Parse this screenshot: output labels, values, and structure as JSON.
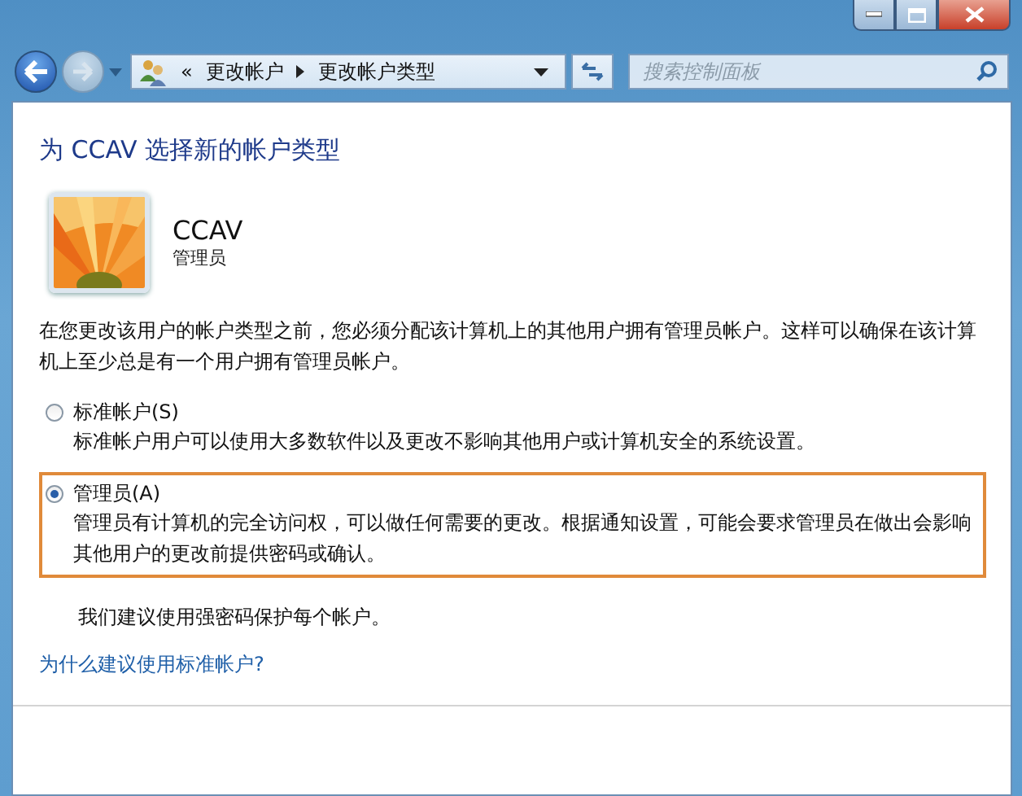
{
  "address_bar": {
    "overflow": "«",
    "crumbs": [
      "更改帐户",
      "更改帐户类型"
    ]
  },
  "search": {
    "placeholder": "搜索控制面板"
  },
  "heading": "为 CCAV 选择新的帐户类型",
  "account": {
    "name": "CCAV",
    "role": "管理员"
  },
  "intro": "在您更改该用户的帐户类型之前，您必须分配该计算机上的其他用户拥有管理员帐户。这样可以确保在该计算机上至少总是有一个用户拥有管理员帐户。",
  "options": [
    {
      "label": "标准帐户(S)",
      "description": "标准帐户用户可以使用大多数软件以及更改不影响其他用户或计算机安全的系统设置。",
      "selected": false,
      "highlighted": false
    },
    {
      "label": "管理员(A)",
      "description": "管理员有计算机的完全访问权，可以做任何需要的更改。根据通知设置，可能会要求管理员在做出会影响其他用户的更改前提供密码或确认。",
      "selected": true,
      "highlighted": true
    }
  ],
  "recommendation": "我们建议使用强密码保护每个帐户。",
  "link": "为什么建议使用标准帐户?"
}
